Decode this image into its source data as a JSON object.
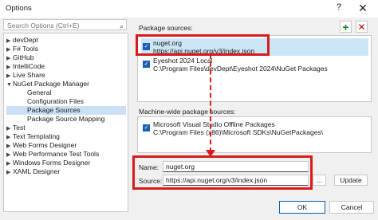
{
  "window": {
    "title": "Options",
    "help_glyph": "?",
    "close_glyph": "✕"
  },
  "search": {
    "placeholder": "Search Options (Ctrl+E)",
    "icon": "search-icon"
  },
  "tree": {
    "items": [
      {
        "label": "devDept",
        "expanded": false
      },
      {
        "label": "F# Tools",
        "expanded": false
      },
      {
        "label": "GitHub",
        "expanded": false
      },
      {
        "label": "IntelliCode",
        "expanded": false
      },
      {
        "label": "Live Share",
        "expanded": false
      },
      {
        "label": "NuGet Package Manager",
        "expanded": true
      },
      {
        "label": "General"
      },
      {
        "label": "Configuration Files"
      },
      {
        "label": "Package Sources",
        "selected": true
      },
      {
        "label": "Package Source Mapping"
      },
      {
        "label": "Test",
        "expanded": false
      },
      {
        "label": "Text Templating",
        "expanded": false
      },
      {
        "label": "Web Forms Designer",
        "expanded": false
      },
      {
        "label": "Web Performance Test Tools",
        "expanded": false
      },
      {
        "label": "Windows Forms Designer",
        "expanded": false
      },
      {
        "label": "XAML Designer",
        "expanded": false
      }
    ]
  },
  "package_sources": {
    "label": "Package sources:",
    "add_glyph": "+",
    "remove_glyph": "✕",
    "items": [
      {
        "name": "nuget.org",
        "url": "https://api.nuget.org/v3/index.json",
        "checked": true,
        "selected": true
      },
      {
        "name": "Eyeshot 2024 Local",
        "url": "C:\\Program Files\\devDept\\Eyeshot 2024\\NuGet Packages",
        "checked": true
      }
    ]
  },
  "machine_sources": {
    "label": "Machine-wide package sources:",
    "items": [
      {
        "name": "Microsoft Visual Studio Offline Packages",
        "url": "C:\\Program Files (x86)\\Microsoft SDKs\\NuGetPackages\\",
        "checked": true
      }
    ]
  },
  "form": {
    "name_label": "Name:",
    "name_value": "nuget.org",
    "source_label": "Source:",
    "source_value": "https://api.nuget.org/v3/index.json",
    "browse_label": "...",
    "update_label": "Update"
  },
  "footer": {
    "ok_label": "OK",
    "cancel_label": "Cancel"
  },
  "colors": {
    "highlight": "#d81b1b",
    "accent": "#1e5fb4"
  }
}
